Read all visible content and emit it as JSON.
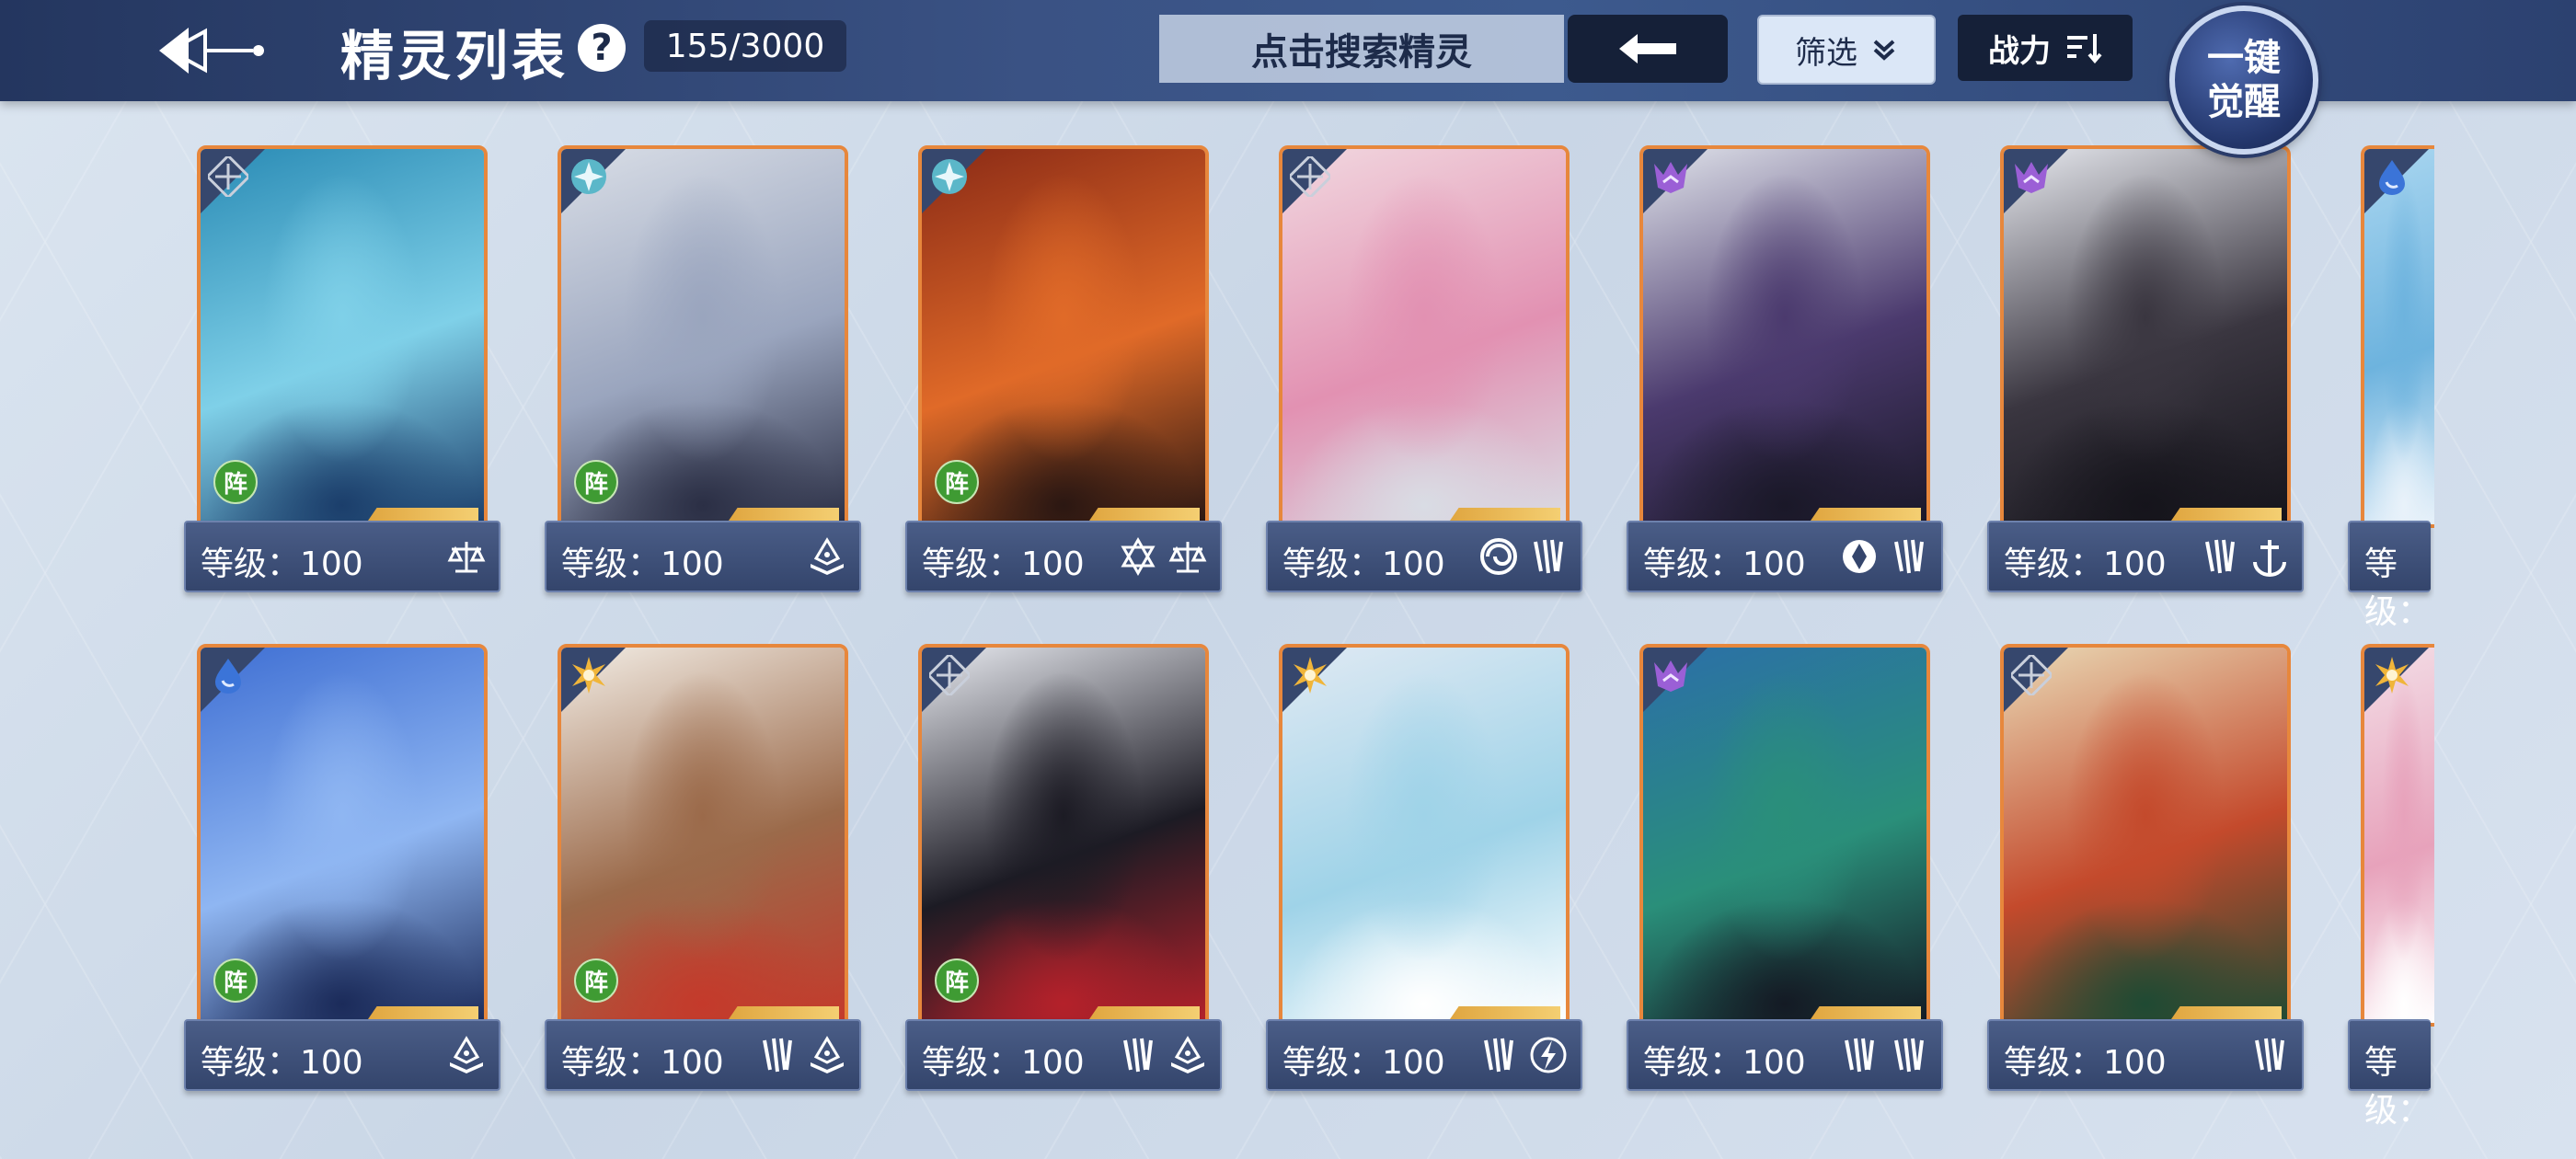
{
  "header": {
    "title": "精灵列表",
    "help_label": "?",
    "count": "155/3000",
    "search_placeholder": "点击搜索精灵",
    "filter_label": "筛选",
    "sort_label": "战力",
    "awaken_line1": "一键",
    "awaken_line2": "觉醒"
  },
  "cards": [
    {
      "level": "等级：100",
      "element": "void-icon",
      "formation": "阵",
      "skills": [
        "scale-icon"
      ],
      "art": [
        "#2a8bb5",
        "#7fd0e8",
        "#1b3e6b"
      ]
    },
    {
      "level": "等级：100",
      "element": "ice-icon",
      "formation": "阵",
      "skills": [
        "book-icon"
      ],
      "art": [
        "#d8dde6",
        "#9aa5be",
        "#2b2f45"
      ]
    },
    {
      "level": "等级：100",
      "element": "ice-icon",
      "formation": "阵",
      "skills": [
        "star-icon",
        "scale-icon"
      ],
      "art": [
        "#8a2a16",
        "#e06a28",
        "#2b1712"
      ]
    },
    {
      "level": "等级：100",
      "element": "void-icon",
      "formation": "",
      "skills": [
        "swirl-icon",
        "claw-icon"
      ],
      "art": [
        "#f1d7df",
        "#e291b2",
        "#d9dce4"
      ]
    },
    {
      "level": "等级：100",
      "element": "demon-icon",
      "formation": "",
      "skills": [
        "shield-icon",
        "claw-icon"
      ],
      "art": [
        "#dfe2ea",
        "#4b3a6e",
        "#1a1828"
      ]
    },
    {
      "level": "等级：100",
      "element": "demon-icon",
      "formation": "",
      "skills": [
        "claw-icon",
        "anchor-icon"
      ],
      "art": [
        "#e6e8ee",
        "#3a3640",
        "#15141b"
      ]
    },
    {
      "level": "等级：",
      "element": "water-icon",
      "formation": "",
      "skills": [],
      "art": [
        "#a9d6f0",
        "#6db3de",
        "#e9f2fa"
      ]
    },
    {
      "level": "等级：100",
      "element": "water-icon",
      "formation": "阵",
      "skills": [
        "book-icon"
      ],
      "art": [
        "#3f6fd3",
        "#8fb6f2",
        "#1b2b5a"
      ]
    },
    {
      "level": "等级：100",
      "element": "light-icon",
      "formation": "阵",
      "skills": [
        "claw-icon",
        "book-icon"
      ],
      "art": [
        "#f2ece4",
        "#9b6a4a",
        "#c43a2b"
      ]
    },
    {
      "level": "等级：100",
      "element": "void-icon",
      "formation": "阵",
      "skills": [
        "claw-icon",
        "book-icon"
      ],
      "art": [
        "#e7e9ef",
        "#1c1b24",
        "#b4212a"
      ]
    },
    {
      "level": "等级：100",
      "element": "light-icon",
      "formation": "",
      "skills": [
        "claw-icon",
        "bolt-icon"
      ],
      "art": [
        "#dfe9f3",
        "#9fd3e8",
        "#ffffff"
      ]
    },
    {
      "level": "等级：100",
      "element": "demon-icon",
      "formation": "",
      "skills": [
        "claw-icon",
        "claw-icon"
      ],
      "art": [
        "#2b6fa8",
        "#2a8f7a",
        "#141a24"
      ]
    },
    {
      "level": "等级：100",
      "element": "void-icon",
      "formation": "",
      "skills": [
        "claw-icon"
      ],
      "art": [
        "#e9d9b5",
        "#c44a2c",
        "#1f4a33"
      ]
    },
    {
      "level": "等级：",
      "element": "light-icon",
      "formation": "",
      "skills": [],
      "art": [
        "#f3dde6",
        "#e7a2bb",
        "#ffffff"
      ]
    }
  ],
  "colors": {
    "card_border": "#e7873c",
    "topbar": "#2c4170",
    "formation_badge": "#3f9b33"
  }
}
